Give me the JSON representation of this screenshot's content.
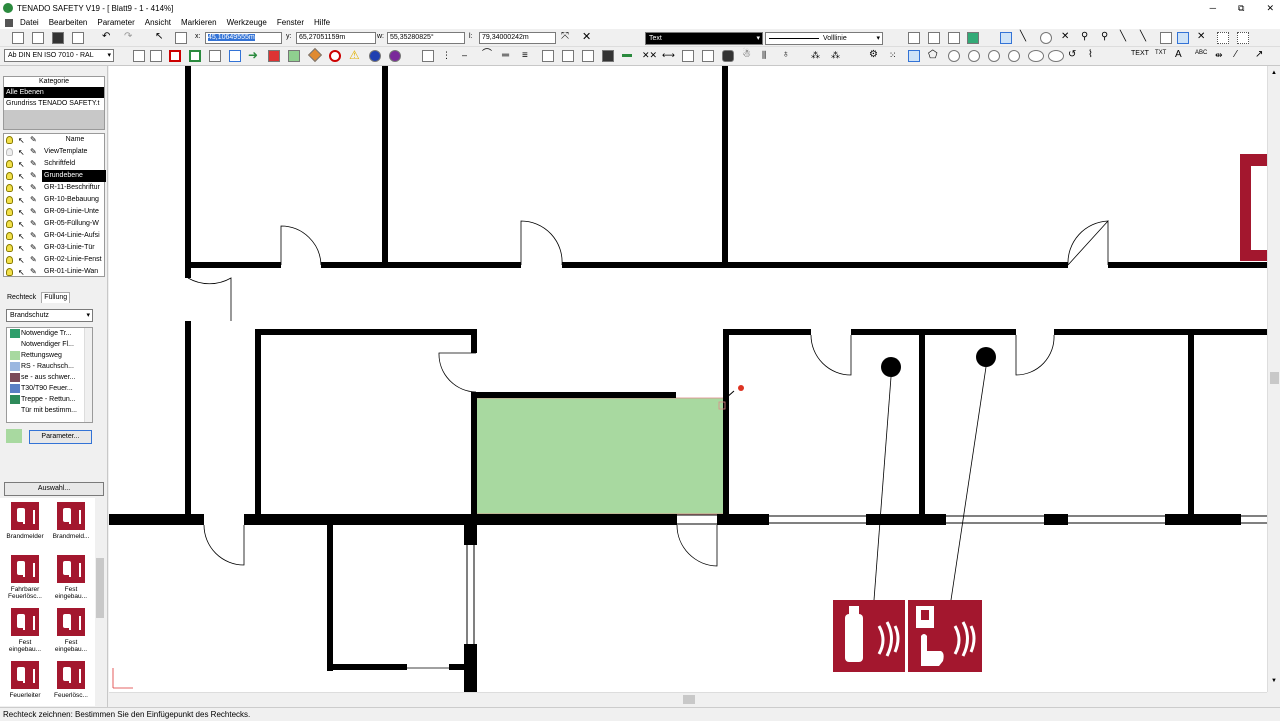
{
  "window": {
    "title": "TENADO SAFETY V19 - [ Blatt9 - 1 - 414%]",
    "minimize": "─",
    "restore": "⧉",
    "close": "✕"
  },
  "menu": [
    "Datei",
    "Bearbeiten",
    "Parameter",
    "Ansicht",
    "Markieren",
    "Werkzeuge",
    "Fenster",
    "Hilfe"
  ],
  "coords": {
    "x_label": "x:",
    "x_value": "45,10649555m",
    "y_label": "y:",
    "y_value": "65,27051159m",
    "w_label": "w:",
    "w_value": "55,35280825°",
    "l_label": "l:",
    "l_value": "79,34000242m"
  },
  "toolbar": {
    "text_dropdown": "Text",
    "linetype_dropdown": "Volllinie",
    "color_dropdown": "Ab DIN EN ISO 7010 - RAL"
  },
  "kategorie": {
    "header": "Kategorie",
    "items": [
      "Alle Ebenen",
      "Grundriss TENADO SAFETY.t"
    ]
  },
  "layers": {
    "header": "Name",
    "items": [
      "ViewTemplate",
      "Schriftfeld",
      "Grundebene",
      "GR-11-Beschriftur",
      "GR-10-Bebauung",
      "GR-09-Linie-Unte",
      "GR-05-Füllung-W",
      "GR-04-Linie-Aufsi",
      "GR-03-Linie-Tür",
      "GR-02-Linie-Fenst",
      "GR-01-Linie-Wan"
    ]
  },
  "tabs": [
    "Rechteck",
    "Füllung"
  ],
  "fill": {
    "dropdown": "Brandschutz",
    "items": [
      {
        "label": "Notwendige Tr...",
        "color": "#2e9e6b"
      },
      {
        "label": "Notwendiger Fl...",
        "color": "#ffffff"
      },
      {
        "label": "Rettungsweg",
        "color": "#a8d9a0"
      },
      {
        "label": "RS - Rauchsch...",
        "color": "#9bb7e0"
      },
      {
        "label": "se - aus schwer...",
        "color": "#7a4a5a"
      },
      {
        "label": "T30/T90 Feuer...",
        "color": "#5b7fc4"
      },
      {
        "label": "Treppe - Rettun...",
        "color": "#2e8a5a"
      },
      {
        "label": "Tür mit bestimm...",
        "color": "#ffffff"
      }
    ],
    "param_button": "Parameter...",
    "preview_color": "#a8d9a0"
  },
  "auswahl_button": "Auswahl...",
  "symbols": [
    {
      "label": "Brandmelder"
    },
    {
      "label": "Brandmeld..."
    },
    {
      "label": "Fahrbarer Feuerlösc..."
    },
    {
      "label": "Fest eingebau..."
    },
    {
      "label": "Fest eingebau..."
    },
    {
      "label": "Fest eingebau..."
    },
    {
      "label": "Feuerleiter"
    },
    {
      "label": "Feuerlösc..."
    }
  ],
  "colors": {
    "fill_highlight": "#a8d9a0",
    "sign_red": "#a3172e",
    "wall": "#000000"
  },
  "status": "Rechteck zeichnen: Bestimmen Sie den Einfügepunkt des Rechtecks."
}
